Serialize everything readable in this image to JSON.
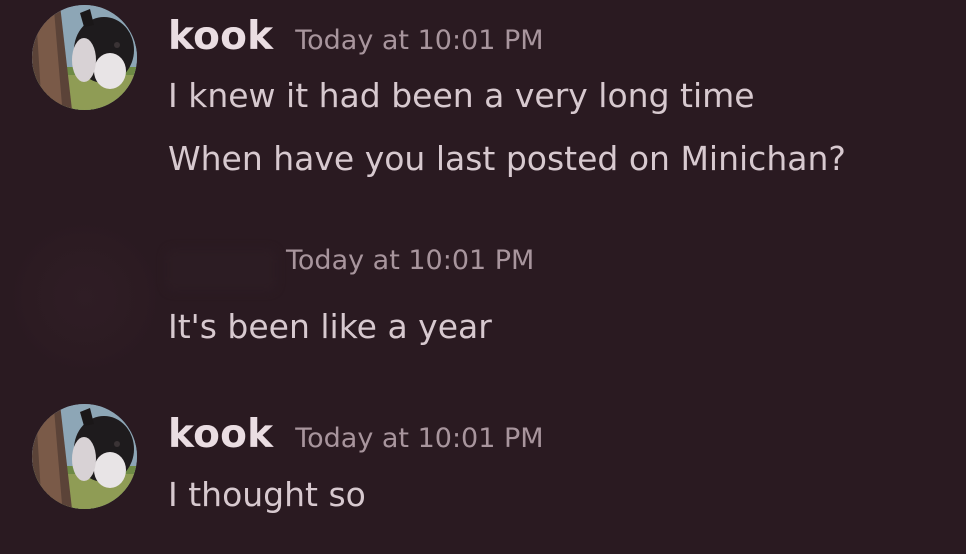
{
  "messages": [
    {
      "author": "kook",
      "timestamp": "Today at 10:01 PM",
      "lines": [
        "I knew it had been a very long time",
        "When have you last posted on Minichan?"
      ]
    },
    {
      "author": "",
      "timestamp": "Today at 10:01 PM",
      "lines": [
        "It's been like a year"
      ]
    },
    {
      "author": "kook",
      "timestamp": "Today at 10:01 PM",
      "lines": [
        "I thought so"
      ]
    }
  ],
  "colors": {
    "background": "#2a1a21",
    "username": "#eadde2",
    "timestamp": "#a8959d",
    "message_text": "#d7c9cf"
  },
  "icons": {
    "avatar": "dog-photo-avatar"
  }
}
